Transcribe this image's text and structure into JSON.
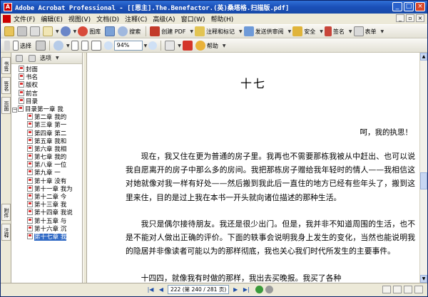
{
  "window": {
    "title": "Adobe Acrobat Professional - [[恩主].The.Benefactor.(英)桑塔格.扫描版.pdf]",
    "buttons": {
      "minimize": "_",
      "maximize": "□",
      "close": "×"
    }
  },
  "menu": {
    "items": [
      "文件(F)",
      "编辑(E)",
      "视图(V)",
      "文档(D)",
      "注释(C)",
      "高级(A)",
      "窗口(W)",
      "帮助(H)"
    ]
  },
  "toolbar1": {
    "labels": {
      "organizer": "图库",
      "search": "搜索",
      "create_pdf": "创建 PDF",
      "comment_markup": "注释和标记",
      "send_review": "发送供审阅",
      "secure": "安全",
      "sign": "签名",
      "forms": "表单"
    }
  },
  "toolbar2": {
    "select_label": "选择",
    "zoom_value": "94%",
    "help_label": "帮助"
  },
  "left_tabs": {
    "bookmarks": "书签",
    "signatures": "签名",
    "pages": "页面",
    "attachments": "附件",
    "comments": "注释"
  },
  "nav_panel": {
    "options_label": "选项"
  },
  "bookmarks": [
    {
      "label": "封面",
      "level": 1
    },
    {
      "label": "书名",
      "level": 1
    },
    {
      "label": "版权",
      "level": 1
    },
    {
      "label": "前言",
      "level": 1
    },
    {
      "label": "目录",
      "level": 1
    },
    {
      "label": "目录第一章 我",
      "level": 1,
      "expanded": true
    },
    {
      "label": "第二章 我的",
      "level": 2
    },
    {
      "label": "第三章 第一",
      "level": 2
    },
    {
      "label": "第四章 第二",
      "level": 2
    },
    {
      "label": "第五章 我和",
      "level": 2
    },
    {
      "label": "第六章 我相",
      "level": 2
    },
    {
      "label": "第七章 我的",
      "level": 2
    },
    {
      "label": "第八章 一位",
      "level": 2
    },
    {
      "label": "第九章 一",
      "level": 2
    },
    {
      "label": "第十章 没有",
      "level": 2
    },
    {
      "label": "第十一章 我为",
      "level": 2
    },
    {
      "label": "第十二章 今",
      "level": 2
    },
    {
      "label": "第十三章 我",
      "level": 2
    },
    {
      "label": "第十四章 我说",
      "level": 2
    },
    {
      "label": "第十五章 与",
      "level": 2
    },
    {
      "label": "第十六章 沉",
      "level": 2
    },
    {
      "label": "第十七章 我",
      "level": 2,
      "selected": true
    }
  ],
  "document": {
    "chapter_title": "十七",
    "quote": "呵，我的执思！",
    "paragraphs": [
      "现在，我又住在更为普通的房子里。我再也不需要那栋我被从中赶出、也可以说我自愿离开的房子中那么多的房间。我把那栋房子赠给我年轻时的情人——我相信这对她就像对我一样有好处——然后搬到我此后一直住的地方已经有些年头了，搬到这里来住，目的是过上我在本书一开头就向诸位描述的那种生活。",
      "我只是偶尔接待朋友。我还是很少出门。但是，我并非不知道周围的生活，也不是不能对人做出正确的评价。下面的轶事会说明我身上发生的变化，当然也能说明我的隐居并非像读者可能以为的那样彻底，我也关心我们时代所发生的主要事件。",
      "十四四，就像我有时做的那样，我出去买晚报。我买了各种"
    ]
  },
  "status": {
    "page_size": "",
    "page_indicator": "222 (第 240 / 281 页)"
  }
}
